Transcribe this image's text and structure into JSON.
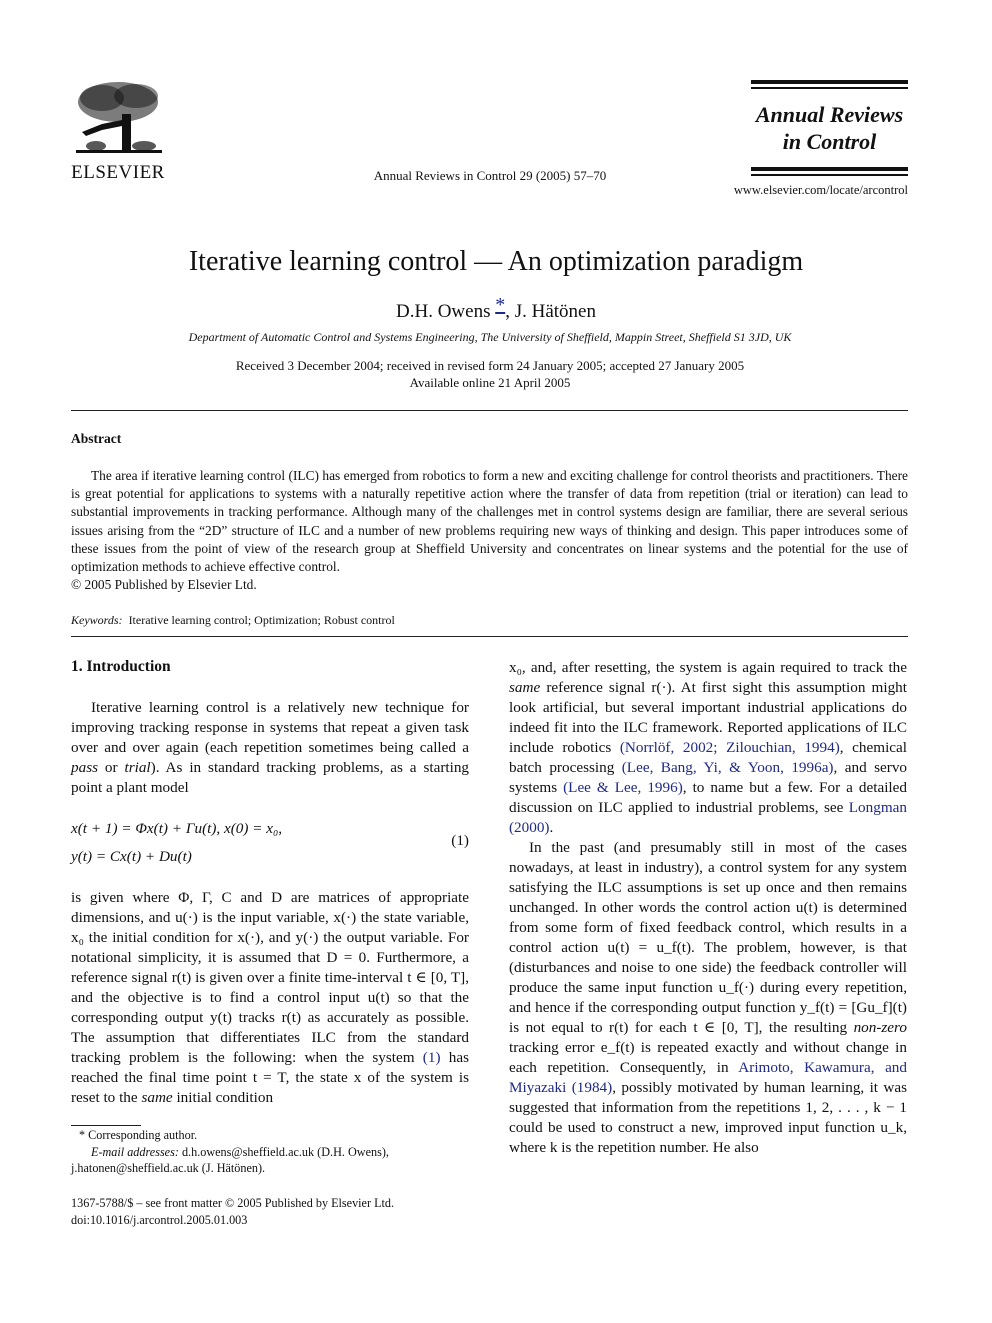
{
  "header": {
    "publisher_wordmark": "ELSEVIER",
    "publisher_logo_icon": "elsevier-tree-logo",
    "journal_reference": "Annual Reviews in Control 29 (2005) 57–70",
    "journal_name_line1": "Annual Reviews",
    "journal_name_line2": "in Control",
    "journal_url": "www.elsevier.com/locate/arcontrol"
  },
  "article": {
    "title": "Iterative learning control — An optimization paradigm",
    "authors": [
      {
        "name": "D.H. Owens",
        "marker": "*"
      },
      {
        "name": "J. Hätönen"
      }
    ],
    "author_separator": ", ",
    "affiliation": "Department of Automatic Control and Systems Engineering, The University of Sheffield, Mappin Street, Sheffield S1 3JD, UK",
    "received": "Received 3 December 2004; received in revised form 24 January 2005; accepted 27 January 2005",
    "available_online": "Available online 21 April 2005"
  },
  "abstract": {
    "heading": "Abstract",
    "body": "The area if iterative learning control (ILC) has emerged from robotics to form a new and exciting challenge for control theorists and practitioners. There is great potential for applications to systems with a naturally repetitive action where the transfer of data from repetition (trial or iteration) can lead to substantial improvements in tracking performance. Although many of the challenges met in control systems design are familiar, there are several serious issues arising from the “2D” structure of ILC and a number of new problems requiring new ways of thinking and design. This paper introduces some of these issues from the point of view of the research group at Sheffield University and concentrates on linear systems and the potential for the use of optimization methods to achieve effective control.",
    "copyright": "© 2005 Published by Elsevier Ltd.",
    "keywords_label": "Keywords:",
    "keywords": "Iterative learning control; Optimization; Robust control"
  },
  "section1": {
    "heading": "1.  Introduction",
    "p1": {
      "t1": "Iterative learning control is a relatively new technique for improving tracking response in systems that repeat a given task over and over again (each repetition sometimes being called a ",
      "e1": "pass",
      "t2": " or ",
      "e2": "trial",
      "t3": "). As in standard tracking problems, as a starting point a plant model"
    },
    "equation": {
      "line1": "x(t + 1) = Φx(t) + Γu(t),    x(0) = x₀,",
      "line2": "y(t) = Cx(t) + Du(t)",
      "number": "(1)"
    },
    "p2": {
      "t1": "is given where Φ, Γ, C and D are matrices of appropriate dimensions, and u(·) is the input variable, x(·) the state variable, x₀ the initial condition for x(·), and y(·) the output variable. For notational simplicity, it is assumed that D = 0. Furthermore, a reference signal r(t) is given over a finite time-interval t ∈ [0, T], and the objective is to find a control input u(t) so that the corresponding output y(t) tracks r(t) as accurately as possible. The assumption that differentiates ILC from the standard tracking problem is the following: when the system ",
      "ref": "(1)",
      "t2": " has reached the final time point t = T, the state x of the system is reset to the ",
      "e1": "same",
      "t3": " initial condition"
    },
    "right_p1": {
      "t1": "x₀, and, after resetting, the system is again required to track the ",
      "e1": "same",
      "t2": " reference signal r(·). At first sight this assumption might look artificial, but several important industrial applications do indeed fit into the ILC framework. Reported applications of ILC include robotics ",
      "ref1": "(Norrlöf, 2002; Zilouchian, 1994)",
      "t3": ", chemical batch processing ",
      "ref2": "(Lee, Bang, Yi, & Yoon, 1996a)",
      "t4": ", and servo systems ",
      "ref3": "(Lee & Lee, 1996)",
      "t5": ", to name but a few. For a detailed discussion on ILC applied to industrial problems, see ",
      "ref4": "Longman (2000)",
      "t6": "."
    },
    "right_p2": {
      "t1": "In the past (and presumably still in most of the cases nowadays, at least in industry), a control system for any system satisfying the ILC assumptions is set up once and then remains unchanged. In other words the control action u(t) is determined from some form of fixed feedback control, which results in a control action u(t) = u_f(t). The problem, however, is that (disturbances and noise to one side) the feedback controller will produce the same input function u_f(·) during every repetition, and hence if the corresponding output function y_f(t) = [Gu_f](t) is not equal to r(t) for each t ∈ [0, T], the resulting ",
      "e1": "non-zero",
      "t2": " tracking error e_f(t) is repeated exactly and without change in each repetition. Consequently, in ",
      "ref1": "Arimoto, Kawamura, and Miyazaki (1984)",
      "t3": ", possibly motivated by human learning, it was suggested that information from the repetitions 1, 2, . . . , k − 1 could be used to construct a new, improved input function u_k, where k is the repetition number. He also"
    }
  },
  "footnote": {
    "marker": "*",
    "corresponding": "Corresponding author.",
    "email_label": "E-mail addresses:",
    "email1": "d.h.owens@sheffield.ac.uk (D.H. Owens),",
    "email2": "j.hatonen@sheffield.ac.uk (J. Hätönen)."
  },
  "imprint": {
    "line1": "1367-5788/$ – see front matter © 2005 Published by Elsevier Ltd.",
    "doi": "doi:10.1016/j.arcontrol.2005.01.003"
  },
  "colors": {
    "link": "#1f2a85",
    "text": "#111111"
  }
}
